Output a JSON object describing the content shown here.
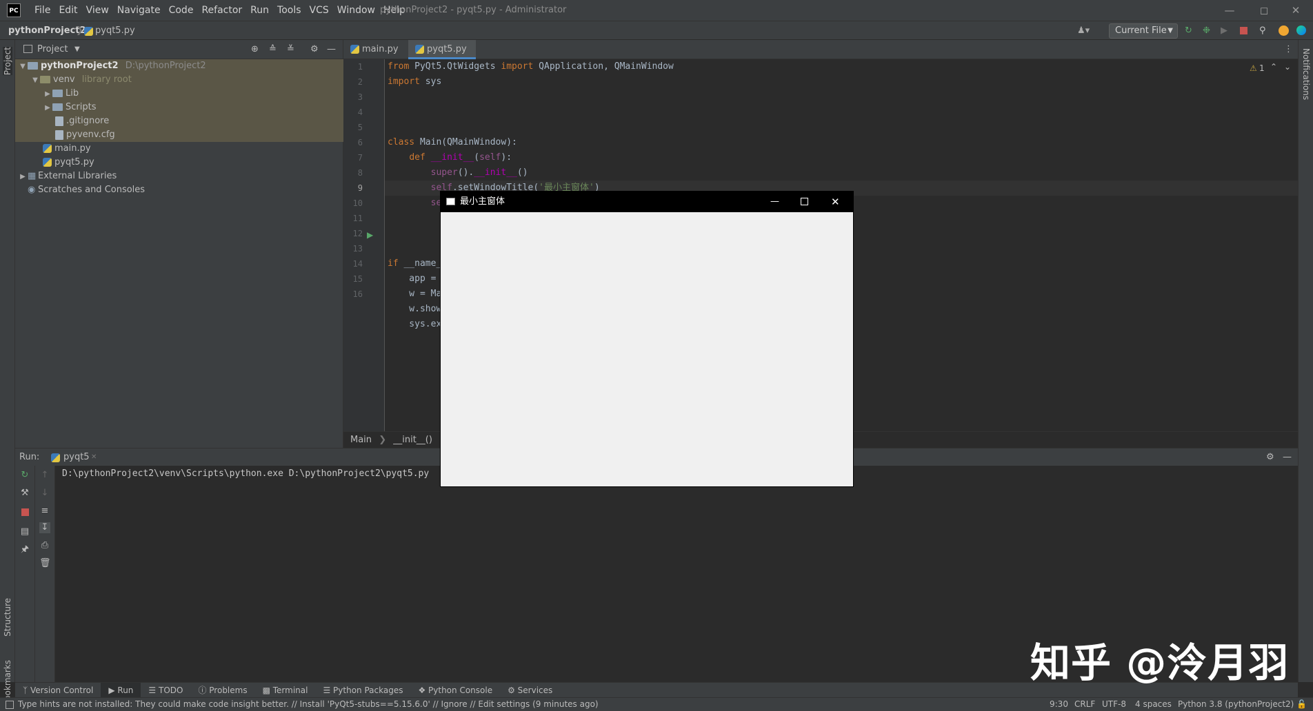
{
  "menubar": {
    "logo": "PC",
    "items": [
      "File",
      "Edit",
      "View",
      "Navigate",
      "Code",
      "Refactor",
      "Run",
      "Tools",
      "VCS",
      "Window",
      "Help"
    ],
    "window_title": "pythonProject2 - pyqt5.py - Administrator"
  },
  "navbar": {
    "project": "pythonProject2",
    "file": "pyqt5.py",
    "run_config": "Current File"
  },
  "left_stripe": {
    "project": "Project",
    "structure": "Structure",
    "bookmarks": "Bookmarks"
  },
  "right_stripe": {
    "notifications": "Notifications"
  },
  "project_panel": {
    "title": "Project",
    "tree": [
      {
        "label": "pythonProject2",
        "hint": "D:\\pythonProject2"
      },
      {
        "label": "venv",
        "hint": "library root"
      },
      {
        "label": "Lib"
      },
      {
        "label": "Scripts"
      },
      {
        "label": ".gitignore"
      },
      {
        "label": "pyvenv.cfg"
      },
      {
        "label": "main.py"
      },
      {
        "label": "pyqt5.py"
      },
      {
        "label": "External Libraries"
      },
      {
        "label": "Scratches and Consoles"
      }
    ]
  },
  "editor": {
    "tabs": [
      {
        "label": "main.py"
      },
      {
        "label": "pyqt5.py"
      }
    ],
    "inspection": "1",
    "line_numbers": [
      "1",
      "2",
      "3",
      "4",
      "5",
      "6",
      "7",
      "8",
      "9",
      "10",
      "11",
      "12",
      "13",
      "14",
      "15",
      "16"
    ],
    "breadcrumb": [
      "Main",
      "__init__()"
    ]
  },
  "run_panel": {
    "label": "Run:",
    "tab": "pyqt5",
    "command": "D:\\pythonProject2\\venv\\Scripts\\python.exe D:\\pythonProject2\\pyqt5.py"
  },
  "bottom_tools": [
    "Version Control",
    "Run",
    "TODO",
    "Problems",
    "Terminal",
    "Python Packages",
    "Python Console",
    "Services"
  ],
  "status": {
    "message": "Type hints are not installed: They could make code insight better. // Install 'PyQt5-stubs==5.15.6.0' // Ignore // Edit settings (9 minutes ago)",
    "position": "9:30",
    "line_sep": "CRLF",
    "encoding": "UTF-8",
    "indent": "4 spaces",
    "interpreter": "Python 3.8 (pythonProject2)"
  },
  "qt_window": {
    "title": "最小主窗体"
  },
  "watermark": "知乎 @泠月羽",
  "colors": {
    "accent": "#4a88c7",
    "keyword": "#cc7832",
    "string": "#6a8759",
    "number": "#6897bb",
    "selection": "#5a5646"
  }
}
